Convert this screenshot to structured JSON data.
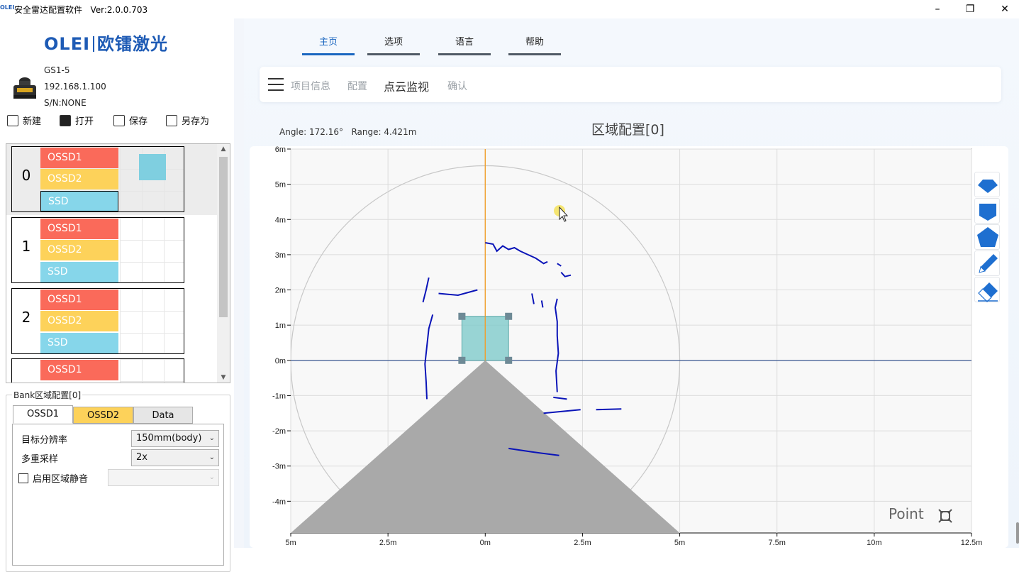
{
  "window": {
    "logo_small": "OLEI",
    "title": "安全雷达配置软件",
    "version": "Ver:2.0.0.703",
    "btn_minimize": "–",
    "btn_restore": "❐",
    "btn_close": "✕"
  },
  "brand": {
    "part1": "OLEI",
    "part2": "欧镭激光"
  },
  "device": {
    "model": "GS1-5",
    "ip": "192.168.1.100",
    "serial": "S/N:NONE"
  },
  "toolbar": {
    "new": "新建",
    "open": "打开",
    "save": "保存",
    "save_as": "另存为"
  },
  "banks": [
    {
      "index": "0",
      "ossd1": "OSSD1",
      "ossd2": "OSSD2",
      "ssd": "SSD"
    },
    {
      "index": "1",
      "ossd1": "OSSD1",
      "ossd2": "OSSD2",
      "ssd": "SSD"
    },
    {
      "index": "2",
      "ossd1": "OSSD1",
      "ossd2": "OSSD2",
      "ssd": "SSD"
    },
    {
      "index": "",
      "ossd1": "OSSD1"
    }
  ],
  "bank_config": {
    "title": "Bank区域配置[0]",
    "tabs": [
      "OSSD1",
      "OSSD2",
      "Data"
    ],
    "resolution_label": "目标分辨率",
    "resolution_value": "150mm(body)",
    "multisample_label": "多重采样",
    "multisample_value": "2x",
    "mute_label": "启用区域静音",
    "mute_checked": false
  },
  "nav": {
    "tabs": [
      "主页",
      "选项",
      "语言",
      "帮助"
    ],
    "active": "主页"
  },
  "breadcrumb": {
    "items": [
      "项目信息",
      "配置",
      "点云监视",
      "确认"
    ],
    "current": "点云监视"
  },
  "readout": {
    "angle": "Angle: 172.16°",
    "range": "Range: 4.421m"
  },
  "panel_title": "区域配置[0]",
  "mode_label": "Point",
  "colors": {
    "accent": "#1a66c0",
    "ossd1": "#fa6a5a",
    "ossd2": "#fdd25a",
    "ssd": "#86d6ea",
    "scan": "#0a14b8",
    "deadzone": "#a9a9a9"
  },
  "chart_data": {
    "type": "scatter",
    "x_ticks": [
      "5m",
      "2.5m",
      "0m",
      "2.5m",
      "5m",
      "7.5m",
      "10m",
      "12.5m"
    ],
    "y_ticks": [
      "6m",
      "5m",
      "4m",
      "3m",
      "2m",
      "1m",
      "0m",
      "-1m",
      "-2m",
      "-3m",
      "-4m"
    ],
    "xlim": [
      -5,
      12.5
    ],
    "ylim": [
      -4.9,
      6
    ],
    "range_circle_radius": 5,
    "zone_rect": {
      "x": [
        -0.6,
        0.6
      ],
      "y": [
        0,
        1.25
      ]
    },
    "tools": [
      "diamond-shape-tool",
      "rectangle-shape-tool",
      "pentagon-shape-tool",
      "pen-tool",
      "eraser-tool"
    ]
  }
}
